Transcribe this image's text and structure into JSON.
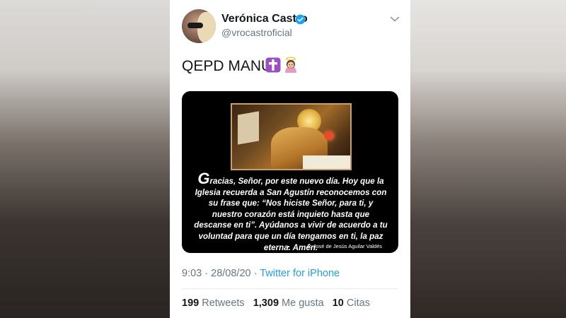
{
  "user": {
    "name": "Verónica Castro",
    "handle": "@vrocastroficial",
    "verified": true
  },
  "tweet": {
    "text": "QEPD MANU",
    "emojis": [
      "latin-cross-emoji",
      "angel-emoji"
    ]
  },
  "media": {
    "quote_dropcap": "G",
    "quote_text": "racias, Señor, por este nuevo día. Hoy que la Iglesia recuerda a San Agustín reconocemos con su frase que: “Nos hiciste Señor, para ti, y nuestro corazón está inquieto hasta que descanse en ti”. Ayúdanos a vivir de acuerdo a tu voluntad para que un día tengamos en ti, la paz eterna. Amén.",
    "credit": "P. José de Jesús Aguilar Valdés"
  },
  "meta": {
    "time": "9:03",
    "separator": "·",
    "date": "28/08/20",
    "source": "Twitter for iPhone"
  },
  "stats": {
    "retweets_count": "199",
    "retweets_label": "Retweets",
    "likes_count": "1,309",
    "likes_label": "Me gusta",
    "quotes_count": "10",
    "quotes_label": "Citas"
  },
  "colors": {
    "accent": "#1da1f2",
    "secondary_text": "#657786",
    "primary_text": "#14171a"
  }
}
